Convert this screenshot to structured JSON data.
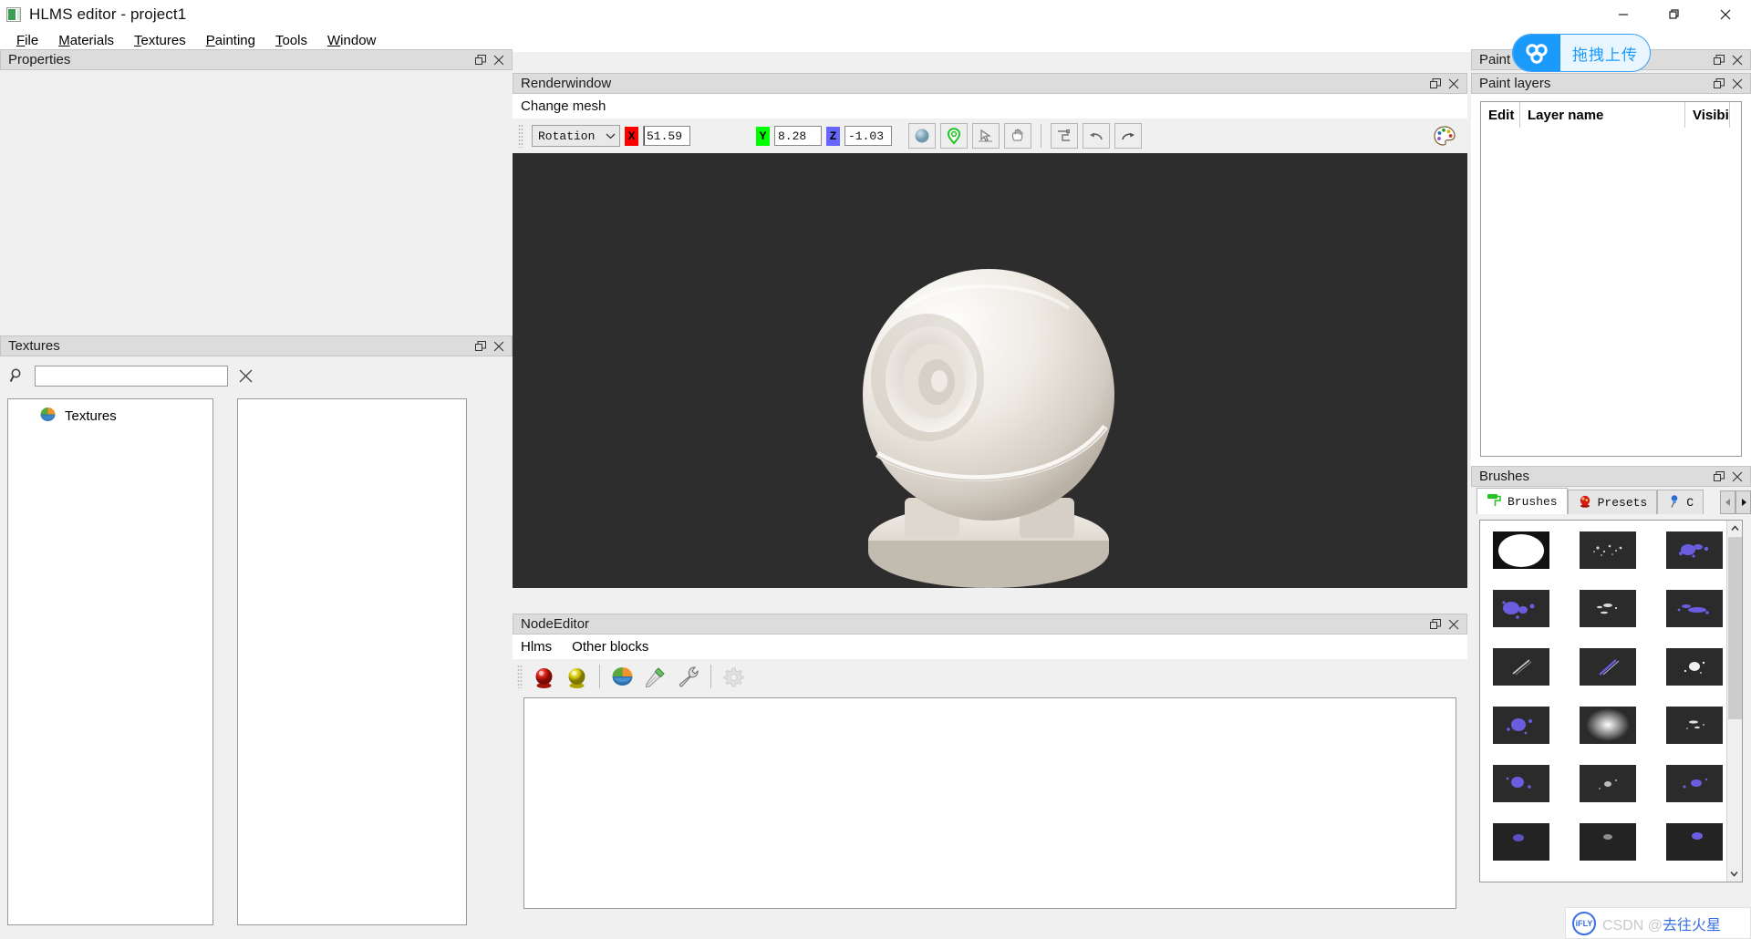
{
  "window": {
    "title": "HLMS editor - project1",
    "icon": "app-icon",
    "controls": {
      "minimize": "minimize-icon",
      "maximize": "maximize-icon",
      "close": "close-icon"
    }
  },
  "menubar": {
    "items": [
      {
        "label": "File",
        "mnemonic": "F"
      },
      {
        "label": "Materials",
        "mnemonic": "M"
      },
      {
        "label": "Textures",
        "mnemonic": "T"
      },
      {
        "label": "Painting",
        "mnemonic": "P"
      },
      {
        "label": "Tools",
        "mnemonic": "T"
      },
      {
        "label": "Window",
        "mnemonic": "W"
      }
    ]
  },
  "panels": {
    "properties": {
      "title": "Properties"
    },
    "textures": {
      "title": "Textures",
      "search_value": "",
      "search_placeholder": "",
      "tree_root": "Textures"
    },
    "renderwindow": {
      "title": "Renderwindow",
      "menu": "Change mesh",
      "toolbar": {
        "mode": "Rotation",
        "x_label": "X",
        "x_value": "51.59",
        "y_label": "Y",
        "y_value": "8.28",
        "z_label": "Z",
        "z_value": "-1.03",
        "buttons": [
          "sphere-mesh-button",
          "light-marker-button",
          "select-tool-button",
          "pan-tool-button",
          "bone-tool-button",
          "undo-button",
          "redo-button"
        ],
        "colors": {
          "x": "#ff0000",
          "y": "#00ff00",
          "z": "#6666ff"
        }
      }
    },
    "nodeeditor": {
      "title": "NodeEditor",
      "menu": [
        "Hlms",
        "Other blocks"
      ],
      "toolbar_icons": [
        "pbs-node-icon",
        "unlit-node-icon",
        "texture-node-icon",
        "pipette-node-icon",
        "wrench-node-icon",
        "gear-settings-icon"
      ]
    },
    "paint": {
      "title": "Paint"
    },
    "paintlayers": {
      "title": "Paint layers",
      "columns": [
        "Edit",
        "Layer name",
        "Visibi"
      ],
      "rows": []
    },
    "brushes": {
      "title": "Brushes",
      "tabs": [
        {
          "label": "Brushes",
          "icon": "paint-roller-icon",
          "active": true
        },
        {
          "label": "Presets",
          "icon": "red-bust-icon",
          "active": false
        },
        {
          "label": "C",
          "icon": "blue-pin-icon",
          "active": false
        }
      ],
      "nav": {
        "prev": "scroll-left-icon",
        "next": "scroll-right-icon"
      },
      "grid": [
        "white-ellipse",
        "speckle-white-1",
        "speckle-blue-1",
        "speckle-blue-2",
        "speckle-white-2",
        "speckle-blue-3",
        "streak-white",
        "streak-blue",
        "burst-white",
        "splat-blue",
        "soft-glow",
        "scatter-white",
        "splat-dark-1",
        "splat-dark-2",
        "splat-dark-3",
        "splat-dark-4",
        "splat-dark-5",
        "splat-dark-6"
      ]
    }
  },
  "overlay": {
    "upload_badge": {
      "text": "拖拽上传",
      "icon": "cloud-upload-icon",
      "color": "#1a9bfc"
    },
    "watermark": {
      "logo": "iFLY",
      "text_prefix": "CSDN @",
      "text_suffix": "去往火星"
    }
  }
}
